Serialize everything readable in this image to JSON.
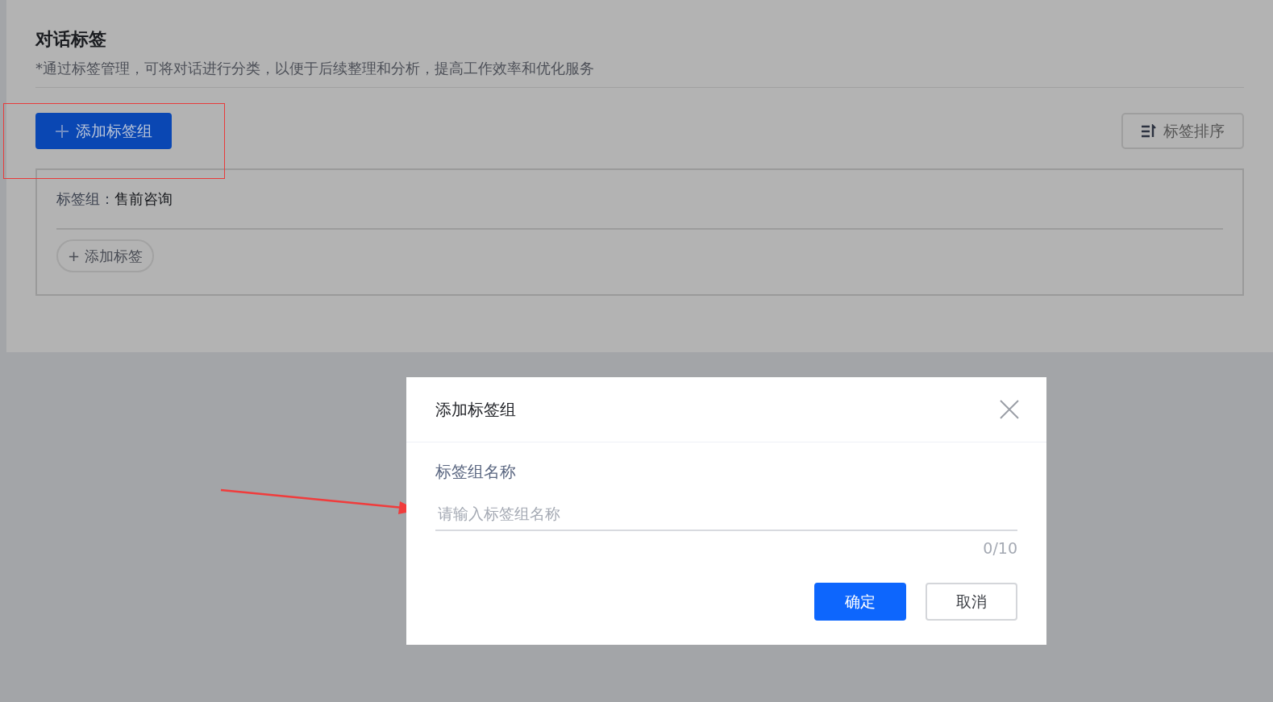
{
  "page": {
    "title": "对话标签",
    "subtitle": "*通过标签管理，可将对话进行分类，以便于后续整理和分析，提高工作效率和优化服务",
    "add_group_button": "添加标签组",
    "sort_button": "标签排序",
    "tag_groups": [
      {
        "label": "标签组：",
        "name": "售前咨询",
        "add_tag_button": "+ 添加标签"
      }
    ]
  },
  "dialog": {
    "title": "添加标签组",
    "field_label": "标签组名称",
    "input": {
      "placeholder": "请输入标签组名称"
    },
    "counter": "0/10",
    "buttons": [
      {
        "label": "确定",
        "kind": "primary"
      },
      {
        "label": "取消",
        "kind": "secondary"
      }
    ]
  }
}
